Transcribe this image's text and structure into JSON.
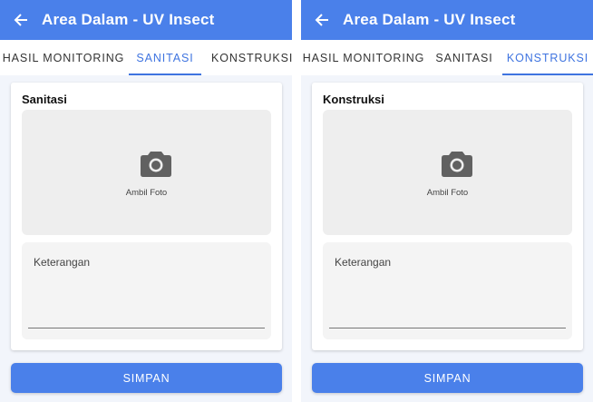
{
  "screens": [
    {
      "appbar": {
        "back_icon": "arrow-left-icon",
        "title": "Area Dalam - UV Insect"
      },
      "tabs": [
        "HASIL MONITORING",
        "SANITASI",
        "KONSTRUKSI"
      ],
      "active_tab": "SANITASI",
      "card": {
        "title": "Sanitasi",
        "photo_label": "Ambil Foto",
        "photo_icon": "camera-icon",
        "note_placeholder": "Keterangan"
      },
      "save_label": "SIMPAN"
    },
    {
      "appbar": {
        "back_icon": "arrow-left-icon",
        "title": "Area Dalam - UV Insect"
      },
      "tabs": [
        "HASIL MONITORING",
        "SANITASI",
        "KONSTRUKSI"
      ],
      "active_tab": "KONSTRUKSI",
      "card": {
        "title": "Konstruksi",
        "photo_label": "Ambil Foto",
        "photo_icon": "camera-icon",
        "note_placeholder": "Keterangan"
      },
      "save_label": "SIMPAN"
    }
  ],
  "colors": {
    "primary": "#4a80ea",
    "active_tab": "#3f74e0",
    "background": "#f2f5fb"
  }
}
